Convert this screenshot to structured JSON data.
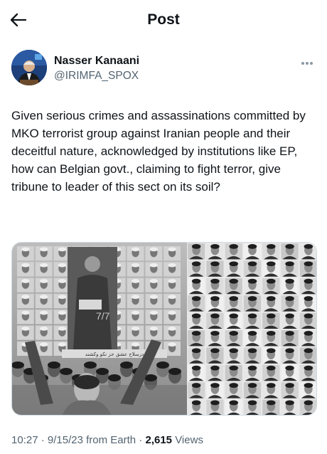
{
  "header": {
    "title": "Post"
  },
  "author": {
    "display_name": "Nasser Kanaani",
    "handle": "@IRIMFA_SPOX"
  },
  "tweet": {
    "text": "Given serious crimes and assassinations committed by MKO terrorist group against Iranian people and their deceitful nature, acknowledged by institutions like EP, how can Belgian govt., claiming to fight terror, give tribune to leader of this sect on its soil?"
  },
  "media": {
    "poster_caption": "درسلاح عشق جز نکو وکشند",
    "poster_handwriting": "7/7"
  },
  "meta": {
    "time": "10:27",
    "date": "9/15/23",
    "source": "from Earth",
    "views_count": "2,615",
    "views_label": "Views"
  },
  "colors": {
    "text": "#0f1419",
    "secondary": "#536471",
    "border": "#cfd9de",
    "avatar_bg": "#1d3f7a"
  }
}
